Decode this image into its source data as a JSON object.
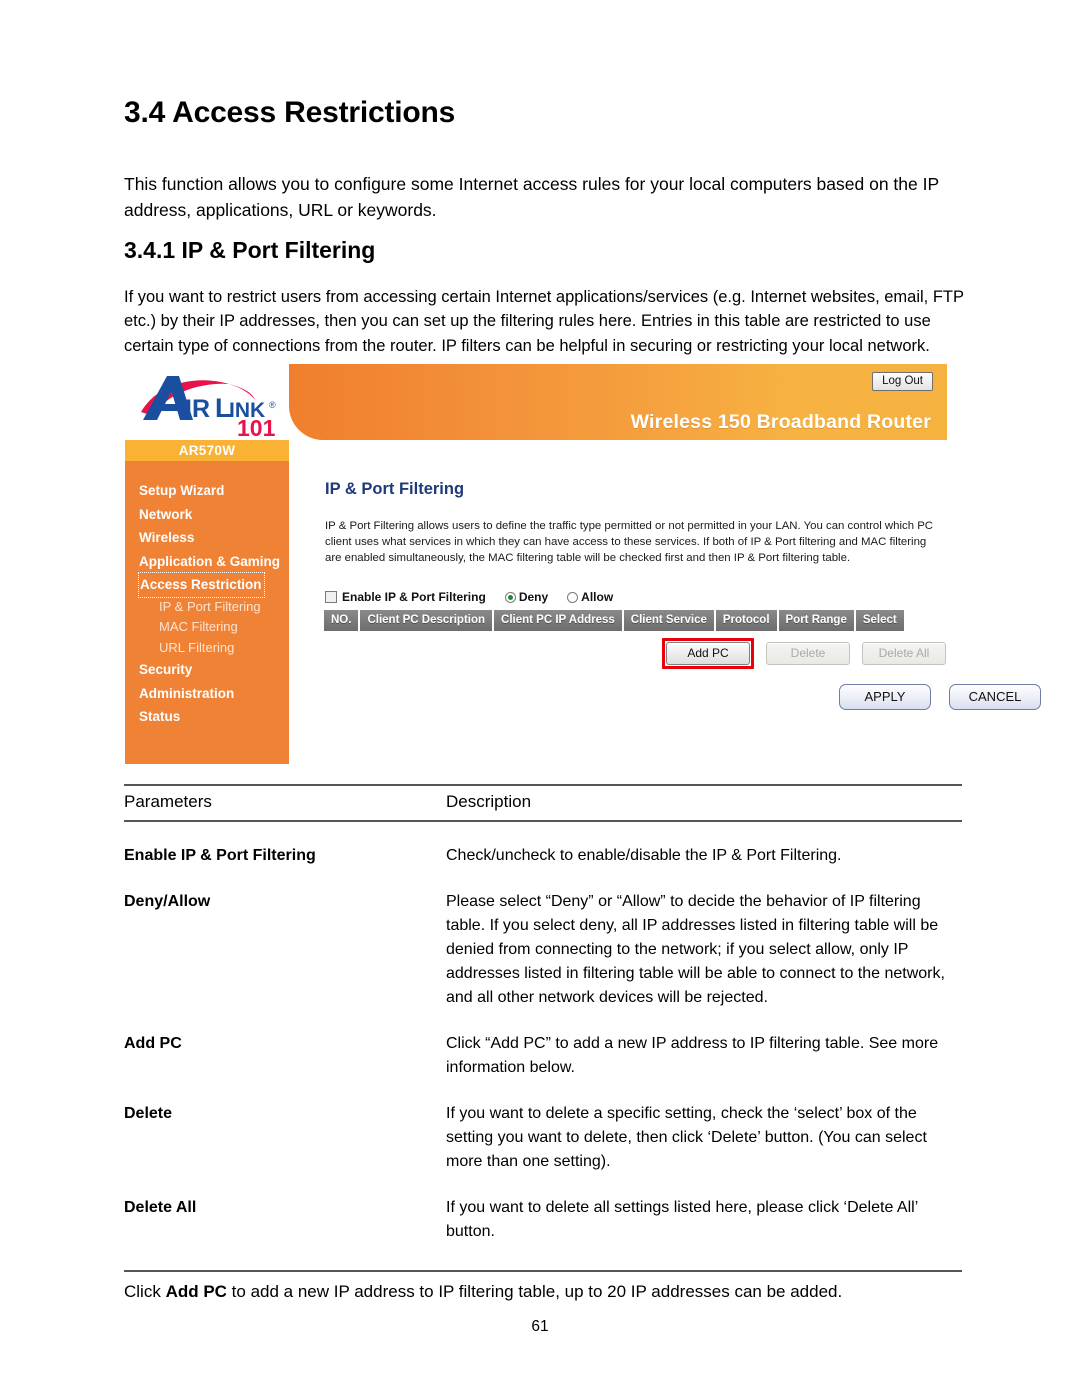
{
  "document": {
    "title": "3.4 Access Restrictions",
    "intro": "This function allows you to configure some Internet access rules for your local computers based on the IP address, applications, URL or keywords.",
    "subtitle": "3.4.1 IP & Port Filtering",
    "sub_intro": "If you want to restrict users from accessing certain Internet applications/services (e.g. Internet websites, email, FTP etc.) by their IP addresses, then you can set up the filtering rules here. Entries in this table are restricted to use certain type of connections from the router. IP filters can be helpful in securing or restricting your local network.",
    "closing_pre": "Click ",
    "closing_bold": "Add PC",
    "closing_post": " to add a new IP address to IP filtering table, up to 20 IP addresses can be added.",
    "page_number": "61"
  },
  "router_ui": {
    "brand": {
      "name_a": "A",
      "name_ir": "IR",
      "name_l": "L",
      "name_ink": "INK",
      "registered": "®",
      "number": "101"
    },
    "header": {
      "product_title": "Wireless 150 Broadband Router",
      "logout_label": "Log Out"
    },
    "model_label": "AR570W",
    "nav": [
      {
        "label": "Setup Wizard",
        "selected": false,
        "sub": false
      },
      {
        "label": "Network",
        "selected": false,
        "sub": false
      },
      {
        "label": "Wireless",
        "selected": false,
        "sub": false
      },
      {
        "label": "Application & Gaming",
        "selected": false,
        "sub": false
      },
      {
        "label": "Access Restriction",
        "selected": true,
        "sub": false
      },
      {
        "label": "IP & Port Filtering",
        "selected": false,
        "sub": true
      },
      {
        "label": "MAC Filtering",
        "selected": false,
        "sub": true
      },
      {
        "label": "URL Filtering",
        "selected": false,
        "sub": true
      },
      {
        "label": "Security",
        "selected": false,
        "sub": false
      },
      {
        "label": "Administration",
        "selected": false,
        "sub": false
      },
      {
        "label": "Status",
        "selected": false,
        "sub": false
      }
    ],
    "panel": {
      "title": "IP & Port Filtering",
      "description": "IP & Port Filtering allows users to define the traffic type permitted or not permitted in your LAN. You can control which PC client uses what services in which they can have access to these services. If both of IP & Port filtering and MAC filtering are enabled simultaneously, the MAC filtering table will be checked first and then IP & Port filtering table.",
      "enable_label": "Enable IP & Port Filtering",
      "enable_checked": false,
      "deny_label": "Deny",
      "allow_label": "Allow",
      "mode_selected": "Deny",
      "table_headers": [
        "NO.",
        "Client PC Description",
        "Client PC IP Address",
        "Client Service",
        "Protocol",
        "Port Range",
        "Select"
      ],
      "buttons": {
        "add_pc": "Add PC",
        "delete": "Delete",
        "delete_all": "Delete All",
        "apply": "APPLY",
        "cancel": "CANCEL"
      },
      "highlight_color": "#e8000b"
    },
    "colors": {
      "sidebar_orange": "#f08236",
      "model_bar": "#f9b233",
      "header_orange_left": "#f07f2d",
      "header_orange_right": "#f6b23f",
      "panel_title_blue": "#1f3a7a"
    }
  },
  "param_table": {
    "header": {
      "col1": "Parameters",
      "col2": "Description"
    },
    "rows": [
      {
        "parameter": "Enable IP & Port Filtering",
        "description": "Check/uncheck to enable/disable the IP & Port Filtering."
      },
      {
        "parameter": "Deny/Allow",
        "description": "Please select “Deny” or “Allow” to decide the behavior of IP filtering table. If you select deny, all IP addresses listed in filtering table will be denied from connecting to the network; if you select allow, only IP addresses listed in filtering table will be able to connect to the network, and all other network devices will be rejected."
      },
      {
        "parameter": "Add PC",
        "description": "Click “Add PC” to add a new IP address to IP filtering table. See more information below."
      },
      {
        "parameter": "Delete",
        "description": "If you want to delete a specific setting, check the ‘select’ box of the setting you want to delete, then click ‘Delete’ button. (You can select more than one setting)."
      },
      {
        "parameter": "Delete All",
        "description": "If you want to delete all settings listed here, please click ‘Delete All’ button."
      }
    ]
  }
}
